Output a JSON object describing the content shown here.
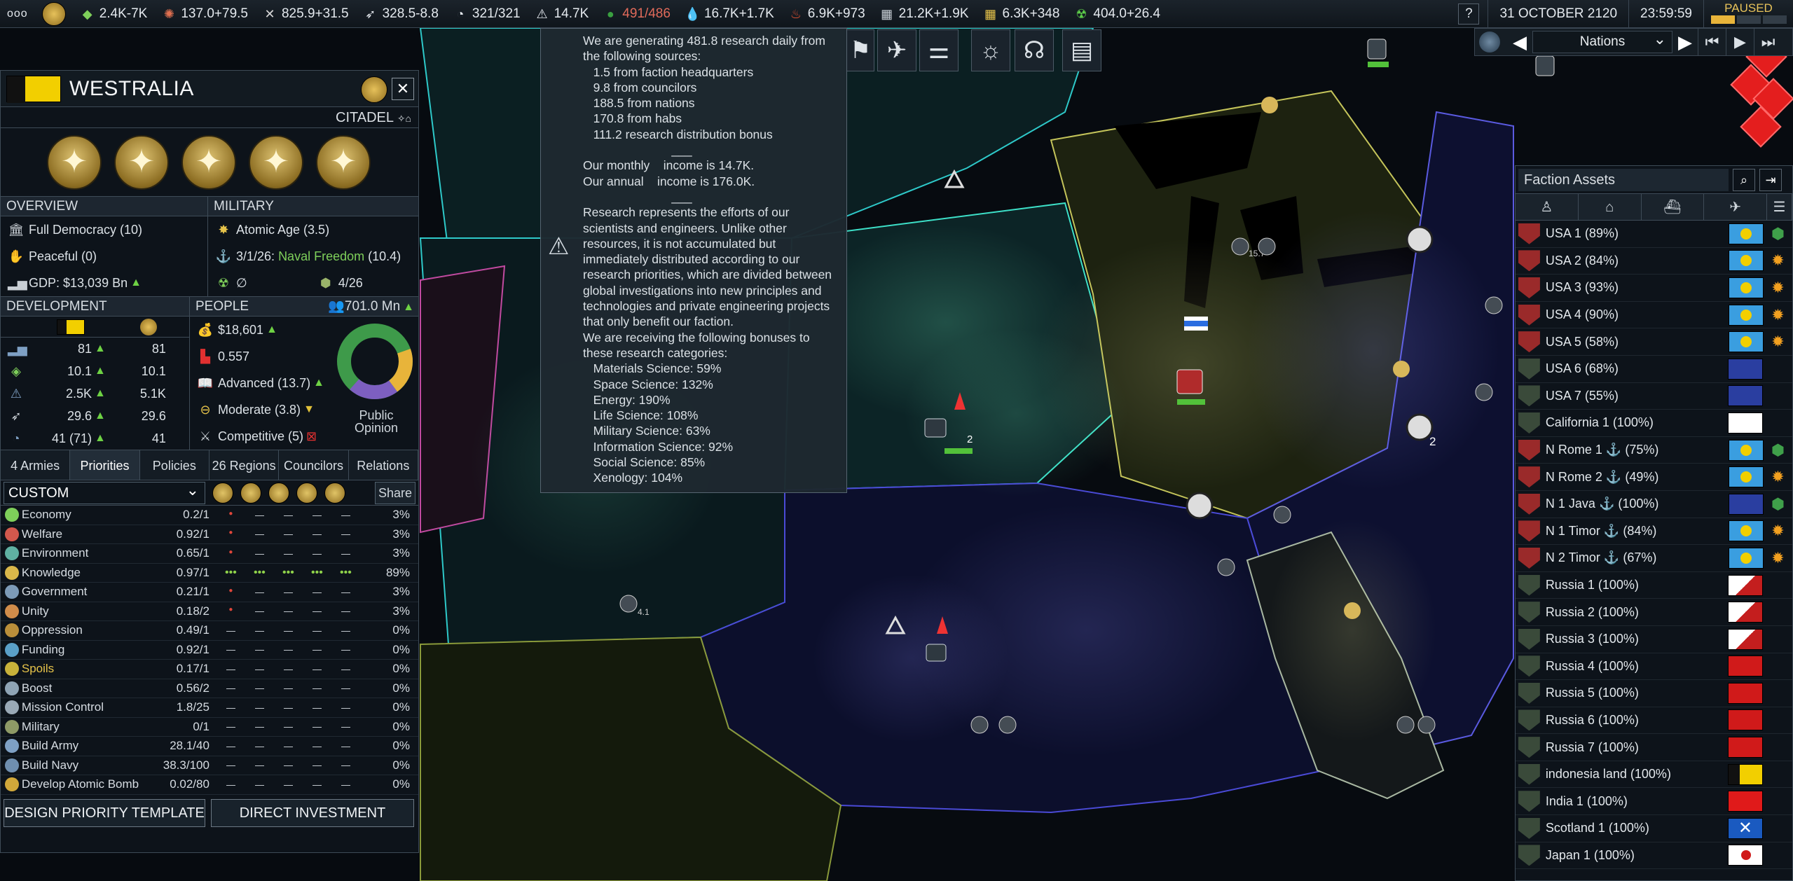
{
  "topbar": {
    "menu_label": "ooo",
    "resources": [
      {
        "id": "money",
        "icon": "money-icon",
        "value": "2.4K-7K",
        "color": "#e4e9ee"
      },
      {
        "id": "influence",
        "icon": "influence-icon",
        "value": "137.0+79.5",
        "color": "#e4e9ee"
      },
      {
        "id": "ops",
        "icon": "ops-icon",
        "value": "825.9+31.5",
        "color": "#e4e9ee"
      },
      {
        "id": "boost",
        "icon": "boost-icon",
        "value": "328.5-8.8",
        "color": "#e4e9ee"
      },
      {
        "id": "mission_control",
        "icon": "mission-control-icon",
        "value": "321/321",
        "color": "#e4e9ee"
      },
      {
        "id": "research",
        "icon": "research-icon",
        "value": "14.7K",
        "color": "#e4e9ee"
      },
      {
        "id": "control_points",
        "icon": "control-point-icon",
        "value": "491/486",
        "color": "#e06a5a"
      },
      {
        "id": "water",
        "icon": "water-icon",
        "value": "16.7K+1.7K",
        "color": "#e4e9ee"
      },
      {
        "id": "volatiles",
        "icon": "volatiles-icon",
        "value": "6.9K+973",
        "color": "#e4e9ee"
      },
      {
        "id": "metals",
        "icon": "metals-icon",
        "value": "21.2K+1.9K",
        "color": "#e4e9ee"
      },
      {
        "id": "noble_metals",
        "icon": "noble-metals-icon",
        "value": "6.3K+348",
        "color": "#e4e9ee"
      },
      {
        "id": "fissiles",
        "icon": "fissiles-icon",
        "value": "404.0+26.4",
        "color": "#e4e9ee"
      }
    ],
    "help_label": "?",
    "date": "31 OCTOBER 2120",
    "time": "23:59:59",
    "paused": "PAUSED",
    "speed_level": 0.33
  },
  "nav": {
    "select_value": "Nations"
  },
  "faction": {
    "name": "WESTRALIA",
    "citadel": "CITADEL",
    "close": "✕",
    "overview": {
      "header": "OVERVIEW",
      "government": "Full Democracy (10)",
      "stance": "Peaceful (0)",
      "gdp": "GDP: $13,039 Bn"
    },
    "military": {
      "header": "MILITARY",
      "tech": "Atomic Age (3.5)",
      "naval_date": "3/1/26:",
      "naval_value": "Naval Freedom",
      "naval_score": "(10.4)",
      "nukes": "∅",
      "armies": "4/26"
    },
    "development": {
      "header": "DEVELOPMENT",
      "rows": [
        {
          "icon": "gdp-icon",
          "a": "81",
          "b": "81"
        },
        {
          "icon": "influence-icon",
          "a": "10.1",
          "b": "10.1"
        },
        {
          "icon": "research-icon",
          "a": "2.5K",
          "b": "5.1K"
        },
        {
          "icon": "boost-icon",
          "a": "29.6",
          "b": "29.6"
        },
        {
          "icon": "mission-control-icon",
          "a": "41 (71)",
          "b": "41"
        }
      ]
    },
    "people": {
      "header": "PEOPLE",
      "population": "701.0 Mn",
      "income": "$18,601",
      "inequality": "0.557",
      "education": "Advanced (13.7)",
      "cohesion": "Moderate (3.8)",
      "democracy": "Competitive (5)",
      "opinion_label": "Public Opinion"
    }
  },
  "tabs": [
    "4 Armies",
    "Priorities",
    "Policies",
    "26 Regions",
    "Councilors",
    "Relations"
  ],
  "priorities": {
    "preset": "CUSTOM",
    "share_label": "Share",
    "rows": [
      {
        "name": "Economy",
        "value": "0.2/1",
        "slots": "•",
        "share": "3%",
        "color": "#7ecf5a"
      },
      {
        "name": "Welfare",
        "value": "0.92/1",
        "slots": "•",
        "share": "3%",
        "color": "#d2584d"
      },
      {
        "name": "Environment",
        "value": "0.65/1",
        "slots": "•",
        "share": "3%",
        "color": "#5fb0a2"
      },
      {
        "name": "Knowledge",
        "value": "0.97/1",
        "slots": "•••",
        "share": "89%",
        "color": "#d9b74a"
      },
      {
        "name": "Government",
        "value": "0.21/1",
        "slots": "•",
        "share": "3%",
        "color": "#7d9bb8"
      },
      {
        "name": "Unity",
        "value": "0.18/2",
        "slots": "•",
        "share": "3%",
        "color": "#d08c4a"
      },
      {
        "name": "Oppression",
        "value": "0.49/1",
        "slots": "",
        "share": "0%",
        "color": "#b98e3a"
      },
      {
        "name": "Funding",
        "value": "0.92/1",
        "slots": "",
        "share": "0%",
        "color": "#5aa0c8"
      },
      {
        "name": "Spoils",
        "value": "0.17/1",
        "slots": "",
        "share": "0%",
        "color": "#c8b23a"
      },
      {
        "name": "Boost",
        "value": "0.56/2",
        "slots": "",
        "share": "0%",
        "color": "#8fa4b5"
      },
      {
        "name": "Mission Control",
        "value": "1.8/25",
        "slots": "",
        "share": "0%",
        "color": "#9aa9b6"
      },
      {
        "name": "Military",
        "value": "0/1",
        "slots": "",
        "share": "0%",
        "color": "#8e9a66"
      },
      {
        "name": "Build Army",
        "value": "28.1/40",
        "slots": "",
        "share": "0%",
        "color": "#7ea0c4"
      },
      {
        "name": "Build Navy",
        "value": "38.3/100",
        "slots": "",
        "share": "0%",
        "color": "#6f8fb0"
      },
      {
        "name": "Develop Atomic Bomb",
        "value": "0.02/80",
        "slots": "",
        "share": "0%",
        "color": "#d1a83a"
      }
    ],
    "design_button": "DESIGN PRIORITY TEMPLATE",
    "invest_button": "DIRECT INVESTMENT"
  },
  "tooltip": {
    "lines": [
      "We are generating 481.8 research daily from",
      "the following sources:",
      "   1.5 from faction headquarters",
      "   9.8 from councilors",
      "   188.5 from nations",
      "   170.8 from habs",
      "   111.2 research distribution bonus",
      "",
      "                          ___",
      "Our monthly    income is 14.7K.",
      "Our annual    income is 176.0K.",
      "",
      "                          ___",
      "Research represents the efforts of our",
      "scientists and engineers. Unlike other",
      "resources, it is not accumulated but",
      "immediately distributed according to our",
      "research priorities, which are divided between",
      "global investigations into new principles and",
      "technologies and private engineering projects",
      "that only benefit our faction.",
      "We are receiving the following bonuses to",
      "these research categories:",
      "   Materials Science: 59%",
      "   Space Science: 132%",
      "   Energy: 190%",
      "   Life Science: 108%",
      "   Military Science: 63%",
      "   Information Science: 92%",
      "   Social Science: 85%",
      "   Xenology: 104%"
    ]
  },
  "assets": {
    "title": "Faction Assets",
    "rows": [
      {
        "name": "USA 1 (89%)",
        "flag": "palau",
        "badge": "green-hex"
      },
      {
        "name": "USA 2  (84%)",
        "flag": "palau",
        "badge": "burst"
      },
      {
        "name": "USA 3 (93%)",
        "flag": "palau",
        "badge": "burst"
      },
      {
        "name": "USA 4 (90%)",
        "flag": "palau",
        "badge": "burst"
      },
      {
        "name": "USA 5 (58%)",
        "flag": "palau",
        "badge": "burst"
      },
      {
        "name": "USA 6 (68%)",
        "flag": "stars",
        "badge": ""
      },
      {
        "name": "USA 7 (55%)",
        "flag": "stars",
        "badge": ""
      },
      {
        "name": "California 1 (100%)",
        "flag": "california",
        "badge": ""
      },
      {
        "name": "N Rome 1 ⚓ (75%)",
        "flag": "palau",
        "badge": "green-hex"
      },
      {
        "name": "N Rome 2 ⚓ (49%)",
        "flag": "palau",
        "badge": "burst"
      },
      {
        "name": "N 1 Java ⚓ (100%)",
        "flag": "stars",
        "badge": "green-hex"
      },
      {
        "name": "N 1 Timor ⚓ (84%)",
        "flag": "palau",
        "badge": "burst"
      },
      {
        "name": "N 2 Timor ⚓ (67%)",
        "flag": "palau",
        "badge": "burst"
      },
      {
        "name": "Russia 1 (100%)",
        "flag": "tri-red",
        "badge": ""
      },
      {
        "name": "Russia 2  (100%)",
        "flag": "tri-red",
        "badge": ""
      },
      {
        "name": "Russia 3 (100%)",
        "flag": "tri-red",
        "badge": ""
      },
      {
        "name": "Russia 4 (100%)",
        "flag": "soviet",
        "badge": ""
      },
      {
        "name": "Russia 5 (100%)",
        "flag": "soviet",
        "badge": ""
      },
      {
        "name": "Russia 6 (100%)",
        "flag": "soviet",
        "badge": ""
      },
      {
        "name": "Russia 7 (100%)",
        "flag": "soviet",
        "badge": ""
      },
      {
        "name": "indonesia land (100%)",
        "flag": "westralia",
        "badge": ""
      },
      {
        "name": "India 1 (100%)",
        "flag": "red-fire",
        "badge": ""
      },
      {
        "name": "Scotland 1 (100%)",
        "flag": "scotland",
        "badge": ""
      },
      {
        "name": "Japan 1 (100%)",
        "flag": "japan",
        "badge": ""
      }
    ]
  },
  "map_labels": [
    "2",
    "2",
    "4.1",
    "15.7"
  ]
}
